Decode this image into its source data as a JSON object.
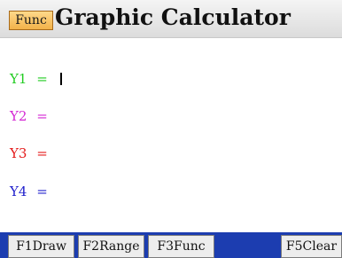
{
  "header": {
    "mode_badge": "Func",
    "title": "Graphic Calculator"
  },
  "functions": [
    {
      "label": "Y1",
      "eq": "=",
      "color": "#22cc22",
      "active": true
    },
    {
      "label": "Y2",
      "eq": "=",
      "color": "#d428d4"
    },
    {
      "label": "Y3",
      "eq": "=",
      "color": "#e41a1a"
    },
    {
      "label": "Y4",
      "eq": "=",
      "color": "#2222cc"
    }
  ],
  "fkeys": [
    {
      "label": "F1Draw"
    },
    {
      "label": "F2Range"
    },
    {
      "label": "F3Func"
    },
    {
      "label": "F5Clear"
    }
  ],
  "colors": {
    "header_bg": "#e6e6e6",
    "mode_badge_bg": "#f6c06a",
    "fkey_bar": "#1c3db0",
    "fkey_bg": "#ededed"
  }
}
